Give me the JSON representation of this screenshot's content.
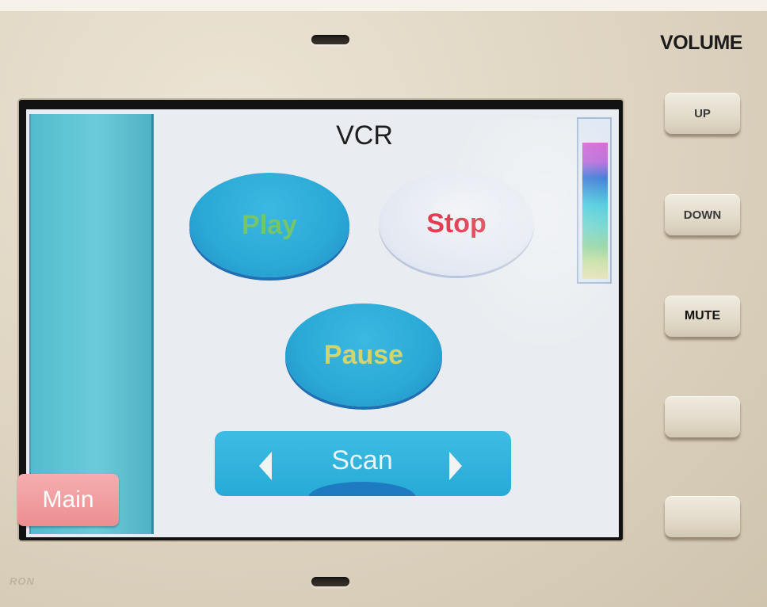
{
  "screen": {
    "title": "VCR",
    "buttons": {
      "play": "Play",
      "stop": "Stop",
      "pause": "Pause"
    },
    "scan": {
      "label": "Scan",
      "prev_icon": "triangle-left-icon",
      "next_icon": "triangle-right-icon"
    },
    "sidebar": {
      "main_label": "Main"
    },
    "volume_level": 0.85
  },
  "hardware": {
    "volume_label": "VOLUME",
    "buttons": [
      "UP",
      "DOWN",
      "MUTE",
      "",
      ""
    ],
    "brand": "RON"
  },
  "colors": {
    "button_blue": "#2aa9d6",
    "play_text": "#75c56b",
    "stop_text": "#e23d50",
    "pause_text": "#d3d46c",
    "main_button": "#f0a0a3",
    "sidebar": "#5cc2d1"
  }
}
